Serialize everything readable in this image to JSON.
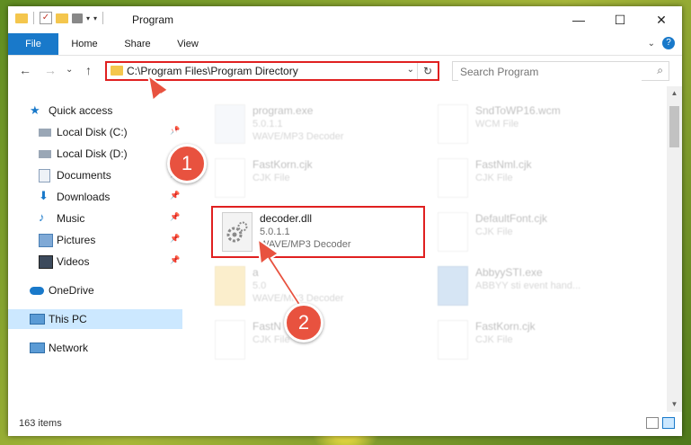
{
  "titlebar": {
    "title": "Program"
  },
  "window_controls": {
    "minimize": "—",
    "maximize": "☐",
    "close": "✕"
  },
  "ribbon": {
    "tabs": [
      "File",
      "Home",
      "Share",
      "View"
    ],
    "help": "?"
  },
  "navbar": {
    "back": "←",
    "forward": "→",
    "recent": "⌄",
    "up": "↑",
    "address": "C:\\Program Files\\Program Directory",
    "search_placeholder": "Search Program"
  },
  "sidebar": {
    "items": [
      {
        "label": "Quick access",
        "icon": "star-icon"
      },
      {
        "label": "Local Disk (C:)",
        "icon": "drive-icon"
      },
      {
        "label": "Local Disk (D:)",
        "icon": "drive-icon"
      },
      {
        "label": "Documents",
        "icon": "documents-icon"
      },
      {
        "label": "Downloads",
        "icon": "download-icon"
      },
      {
        "label": "Music",
        "icon": "music-icon"
      },
      {
        "label": "Pictures",
        "icon": "pictures-icon"
      },
      {
        "label": "Videos",
        "icon": "videos-icon"
      },
      {
        "label": "OneDrive",
        "icon": "cloud-icon"
      },
      {
        "label": "This PC",
        "icon": "computer-icon"
      },
      {
        "label": "Network",
        "icon": "network-icon"
      }
    ]
  },
  "files": [
    {
      "name": "program.exe",
      "line2": "5.0.1.1",
      "line3": "WAVE/MP3 Decoder"
    },
    {
      "name": "SndToWP16.wcm",
      "line2": "WCM File",
      "line3": ""
    },
    {
      "name": "FastKorn.cjk",
      "line2": "CJK File",
      "line3": ""
    },
    {
      "name": "FastNml.cjk",
      "line2": "CJK File",
      "line3": ""
    },
    {
      "name": "decoder.dll",
      "line2": "5.0.1.1",
      "line3": "WAVE/MP3 Decoder"
    },
    {
      "name": "DefaultFont.cjk",
      "line2": "CJK File",
      "line3": ""
    },
    {
      "name": "a",
      "line2": "5.0",
      "line3": "WAVE/MP3 Decoder"
    },
    {
      "name": "AbbyySTI.exe",
      "line2": "ABBYY sti event hand...",
      "line3": ""
    },
    {
      "name": "FastN",
      "line2": "CJK File",
      "line3": ""
    },
    {
      "name": "FastKorn.cjk",
      "line2": "CJK File",
      "line3": ""
    }
  ],
  "annotations": {
    "step1": "1",
    "step2": "2"
  },
  "status": {
    "count": "163 items"
  },
  "colors": {
    "accent": "#1979ca",
    "highlight": "#e02020",
    "badge": "#e8523f",
    "selected": "#cce8ff"
  }
}
